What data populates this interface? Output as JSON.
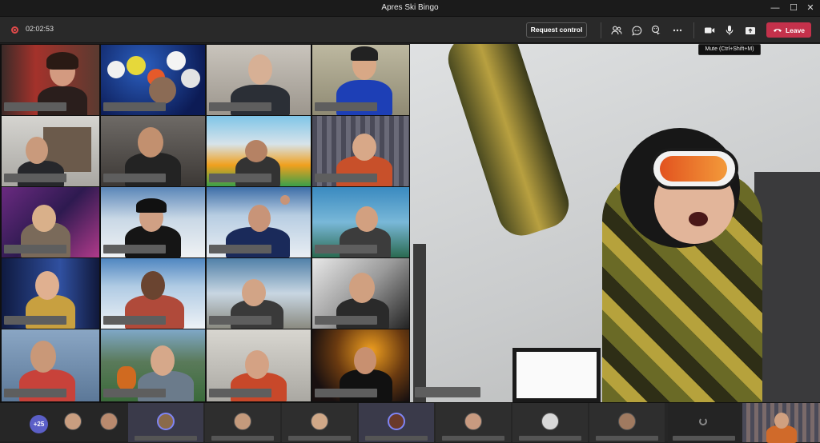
{
  "window": {
    "title": "Apres Ski Bingo",
    "minimize_glyph": "—",
    "maximize_glyph": "☐",
    "close_glyph": "✕"
  },
  "toolbar": {
    "recording_icon": "record-icon",
    "timer": "02:02:53",
    "request_control_label": "Request control",
    "leave_label": "Leave",
    "icons": [
      "participants-icon",
      "chat-icon",
      "reactions-icon",
      "more-options-icon",
      "camera-icon",
      "microphone-icon",
      "share-tray-icon",
      "hang-up-icon"
    ]
  },
  "tooltip": {
    "text": "Mute (Ctrl+Shift+M)"
  },
  "strip": {
    "more_count": "+25"
  },
  "colors": {
    "accent": "#7f85f5",
    "leave": "#c4314b",
    "more_badge": "#5b5fc7"
  }
}
